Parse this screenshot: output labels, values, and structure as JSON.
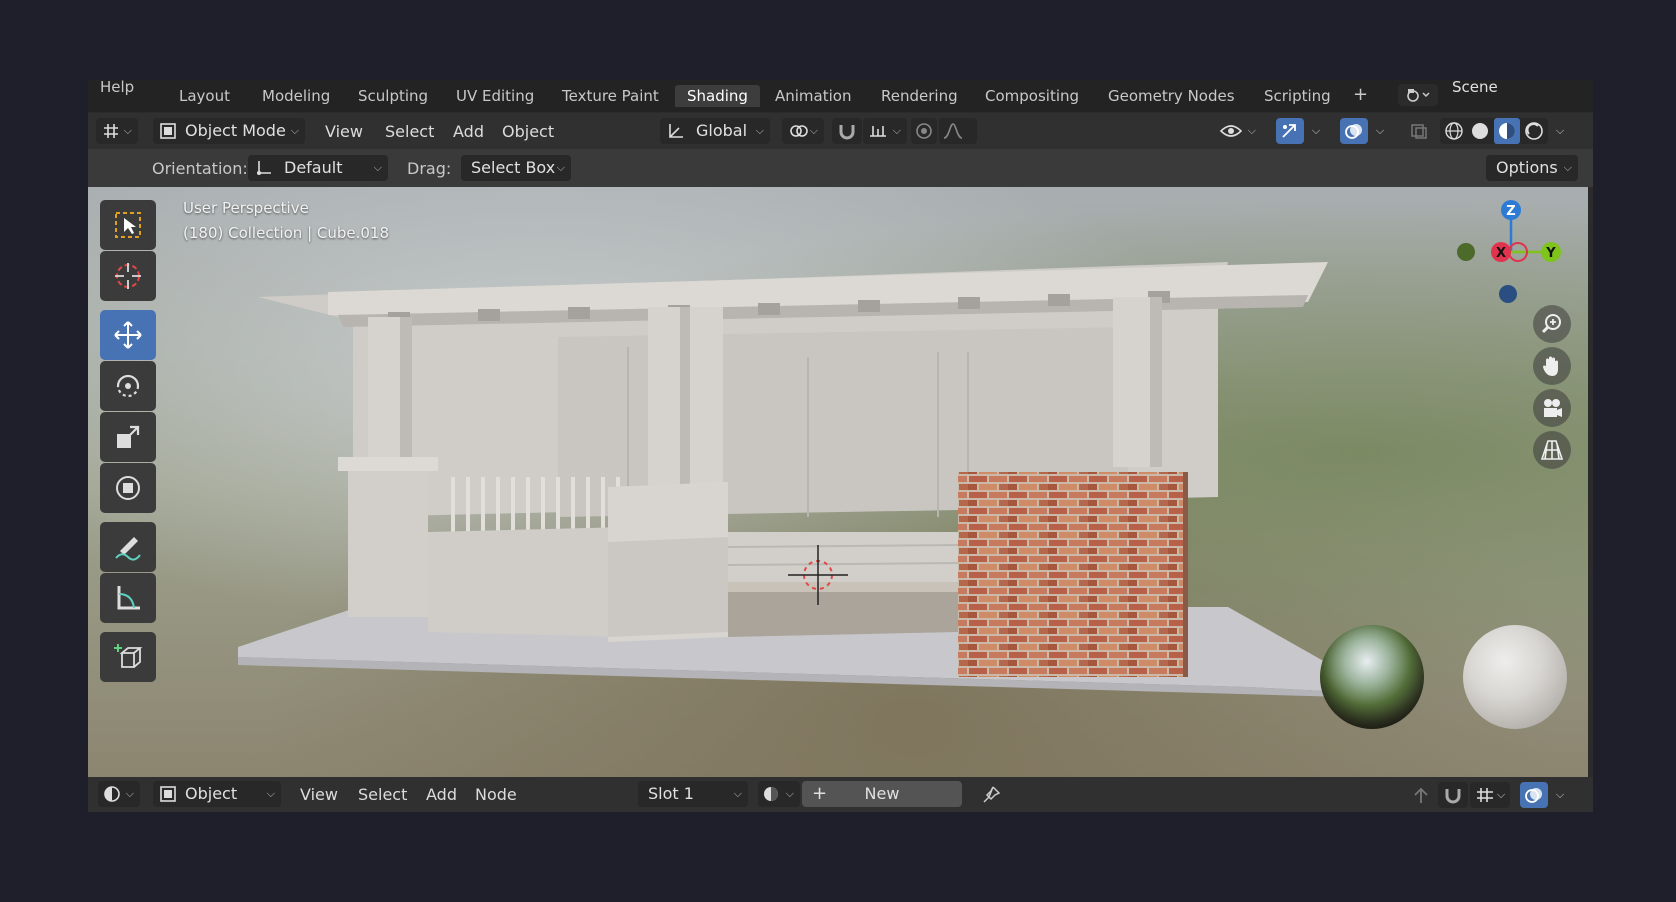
{
  "topbar": {
    "help": "Help",
    "tabs": [
      "Layout",
      "Modeling",
      "Sculpting",
      "UV Editing",
      "Texture Paint",
      "Shading",
      "Animation",
      "Rendering",
      "Compositing",
      "Geometry Nodes",
      "Scripting"
    ],
    "active_tab": "Shading",
    "add_tab": "+",
    "scene_label": "Scene"
  },
  "header": {
    "mode": "Object Mode",
    "menus": [
      "View",
      "Select",
      "Add",
      "Object"
    ],
    "transform_orientation": "Global"
  },
  "tool_settings": {
    "orientation_label": "Orientation:",
    "orientation_value": "Default",
    "drag_label": "Drag:",
    "drag_value": "Select Box",
    "options": "Options"
  },
  "viewport": {
    "view_name": "User Perspective",
    "collection_info": "(180) Collection | Cube.018",
    "gizmo": {
      "z": "Z",
      "x": "X",
      "y": "Y"
    }
  },
  "bottom_bar": {
    "mode": "Object",
    "menus": [
      "View",
      "Select",
      "Add",
      "Node"
    ],
    "slot": "Slot 1",
    "new_button": "New"
  },
  "colors": {
    "active_blue": "#4772b3",
    "axis_x": "#e0334d",
    "axis_y": "#7fc41b",
    "axis_z": "#2e7bd6"
  }
}
